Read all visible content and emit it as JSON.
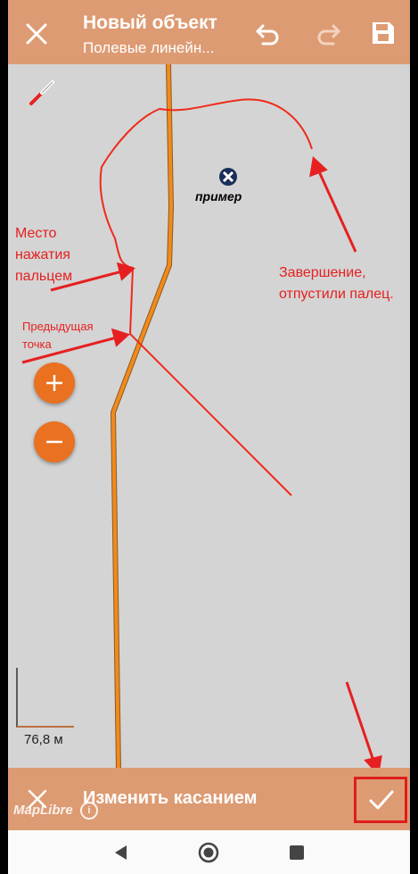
{
  "topbar": {
    "title": "Новый объект",
    "subtitle": "Полевые линейн...",
    "icons": [
      "close-icon",
      "undo-icon",
      "redo-icon",
      "save-icon"
    ]
  },
  "map": {
    "poi_label": "пример",
    "annotations": {
      "finger_place": [
        "Место",
        "нажатия",
        "пальцем"
      ],
      "prev_point": [
        "Предыдущая",
        "точка"
      ],
      "finish": [
        "Завершение,",
        "отпустили палец."
      ]
    },
    "scale_label": "76,8 м",
    "attribution": "MapLibre"
  },
  "bottombar": {
    "title": "Изменить касанием",
    "icons": [
      "close-icon",
      "check-icon"
    ]
  },
  "colors": {
    "toolbar": "#dd9b73",
    "map_background": "#d4d4d4",
    "route": "#f28a1a",
    "annotation": "#e62020",
    "zoom_button": "#e9711f"
  }
}
